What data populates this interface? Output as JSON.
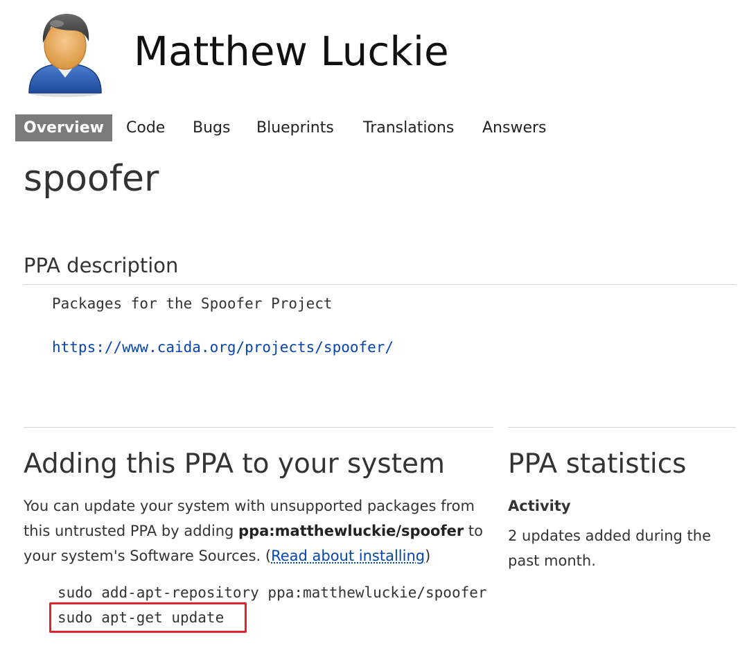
{
  "header": {
    "avatar_icon": "default-person-avatar-icon",
    "person_name": "Matthew Luckie"
  },
  "tabs": [
    {
      "label": "Overview",
      "active": true
    },
    {
      "label": "Code",
      "active": false
    },
    {
      "label": "Bugs",
      "active": false
    },
    {
      "label": "Blueprints",
      "active": false
    },
    {
      "label": "Translations",
      "active": false
    },
    {
      "label": "Answers",
      "active": false
    }
  ],
  "project_title": "spoofer",
  "ppa_description": {
    "heading": "PPA description",
    "text": "Packages for the Spoofer Project",
    "link": "https://www.caida.org/projects/spoofer/"
  },
  "adding_ppa": {
    "heading": "Adding this PPA to your system",
    "line1": "You can update your system with unsupported packages from",
    "line2_prefix": "this untrusted PPA by adding ",
    "ppa_name": "ppa:matthewluckie/spoofer",
    "line2_suffix": " to",
    "line3_prefix": "your system's Software Sources. (",
    "read_link": "Read about installing",
    "line3_suffix": ")",
    "commands": [
      "sudo add-apt-repository ppa:matthewluckie/spoofer",
      "sudo apt-get update"
    ]
  },
  "ppa_statistics": {
    "heading": "PPA statistics",
    "activity_label": "Activity",
    "activity_text": "2 updates added during the past month."
  },
  "colors": {
    "link": "#0645ad",
    "active_tab_bg": "#7b7b7b",
    "highlight_border": "#e0242b"
  }
}
